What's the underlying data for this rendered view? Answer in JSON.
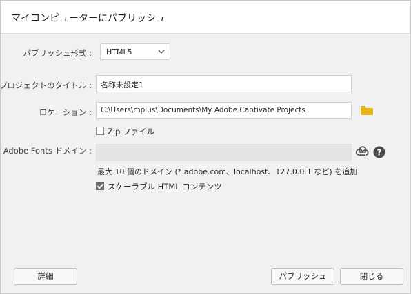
{
  "window": {
    "title": "マイコンピューターにパブリッシュ"
  },
  "form": {
    "format_label": "パブリッシュ形式 :",
    "format_value": "HTML5",
    "title_label": "プロジェクトのタイトル :",
    "title_value": "名称未設定1",
    "location_label": "ロケーション :",
    "location_value": "C:\\Users\\mplus\\Documents\\My Adobe Captivate Projects",
    "zip_label": "Zip ファイル",
    "zip_checked": false,
    "fonts_label": "Adobe Fonts ドメイン :",
    "fonts_value": "",
    "fonts_hint": "最大 10 個のドメイン (*.adobe.com、localhost、127.0.0.1 など) を追加",
    "scalable_label": "スケーラブル HTML コンテンツ",
    "scalable_checked": true
  },
  "icons": {
    "folder": "folder-icon",
    "creative_cloud": "creative-cloud-icon",
    "help": "help-icon",
    "dropdown": "chevron-down-icon"
  },
  "buttons": {
    "details": "詳細",
    "publish": "パブリッシュ",
    "close": "閉じる"
  },
  "colors": {
    "folder": "#e7b416",
    "help": "#4a4a4a",
    "checkbox_checked": "#6c6c6c"
  }
}
